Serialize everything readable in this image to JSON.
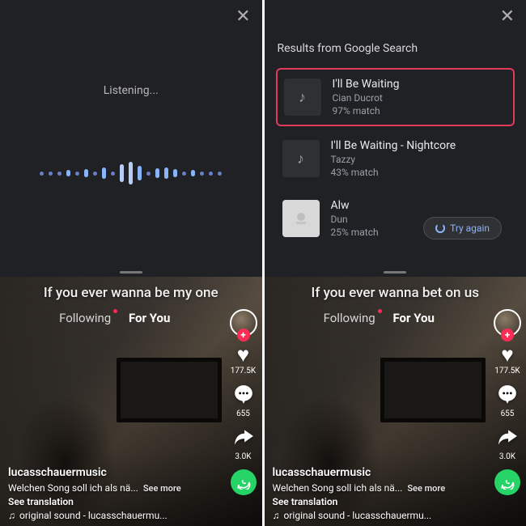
{
  "left": {
    "listening_label": "Listening...",
    "caption": "If you ever wanna be my one"
  },
  "right": {
    "results_title": "Results from Google Search",
    "results": [
      {
        "title": "I'll Be Waiting",
        "artist": "Cian Ducrot",
        "match": "97% match"
      },
      {
        "title": "I'll Be Waiting - Nightcore",
        "artist": "Tazzy",
        "match": "43% match"
      },
      {
        "title": "Alw",
        "artist": "Dun",
        "match": "25% match"
      }
    ],
    "try_again": "Try again",
    "caption": "If you ever wanna bet on us"
  },
  "tiktok": {
    "tabs": {
      "following": "Following",
      "foryou": "For You"
    },
    "likes": "177.5K",
    "comments": "655",
    "shares": "3.0K",
    "username": "lucasschauermusic",
    "description": "Welchen Song soll ich als nä...",
    "see_more": "See more",
    "see_translation": "See translation",
    "sound": "original sound - lucasschauermu..."
  }
}
